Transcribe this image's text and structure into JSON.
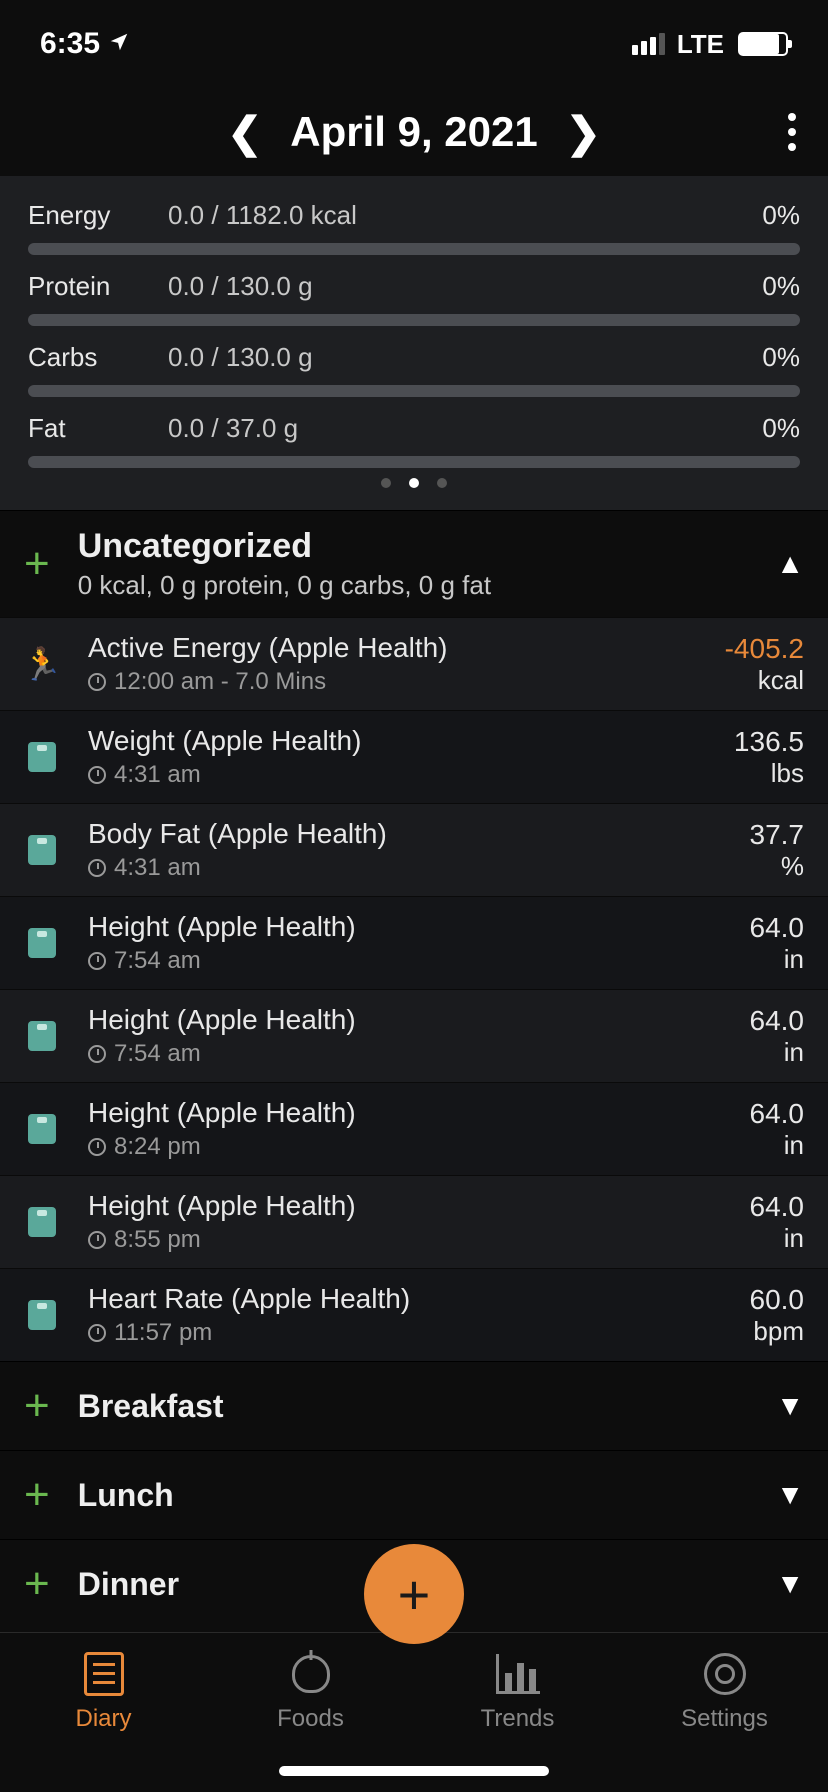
{
  "status": {
    "time": "6:35",
    "network": "LTE"
  },
  "header": {
    "date": "April 9, 2021"
  },
  "macros": [
    {
      "label": "Energy",
      "value": "0.0 / 1182.0 kcal",
      "pct": "0%"
    },
    {
      "label": "Protein",
      "value": "0.0 / 130.0 g",
      "pct": "0%"
    },
    {
      "label": "Carbs",
      "value": "0.0 / 130.0 g",
      "pct": "0%"
    },
    {
      "label": "Fat",
      "value": "0.0 / 37.0 g",
      "pct": "0%"
    }
  ],
  "section": {
    "title": "Uncategorized",
    "sub": "0 kcal, 0 g protein, 0 g carbs, 0 g fat"
  },
  "entries": [
    {
      "icon": "runner",
      "title": "Active Energy (Apple Health)",
      "meta": "12:00 am  - 7.0 Mins",
      "value": "-405.2",
      "unit": "kcal",
      "neg": true
    },
    {
      "icon": "scale",
      "title": "Weight (Apple Health)",
      "meta": "4:31 am",
      "value": "136.5",
      "unit": "lbs"
    },
    {
      "icon": "scale",
      "title": "Body Fat (Apple Health)",
      "meta": "4:31 am",
      "value": "37.7",
      "unit": "%"
    },
    {
      "icon": "scale",
      "title": "Height (Apple Health)",
      "meta": "7:54 am",
      "value": "64.0",
      "unit": "in"
    },
    {
      "icon": "scale",
      "title": "Height (Apple Health)",
      "meta": "7:54 am",
      "value": "64.0",
      "unit": "in"
    },
    {
      "icon": "scale",
      "title": "Height (Apple Health)",
      "meta": "8:24 pm",
      "value": "64.0",
      "unit": "in"
    },
    {
      "icon": "scale",
      "title": "Height (Apple Health)",
      "meta": "8:55 pm",
      "value": "64.0",
      "unit": "in"
    },
    {
      "icon": "scale",
      "title": "Heart Rate (Apple Health)",
      "meta": "11:57 pm",
      "value": "60.0",
      "unit": "bpm"
    }
  ],
  "meals": [
    {
      "title": "Breakfast"
    },
    {
      "title": "Lunch"
    },
    {
      "title": "Dinner"
    }
  ],
  "tabs": [
    {
      "label": "Diary",
      "active": true
    },
    {
      "label": "Foods"
    },
    {
      "label": "Trends"
    },
    {
      "label": "Settings"
    }
  ]
}
